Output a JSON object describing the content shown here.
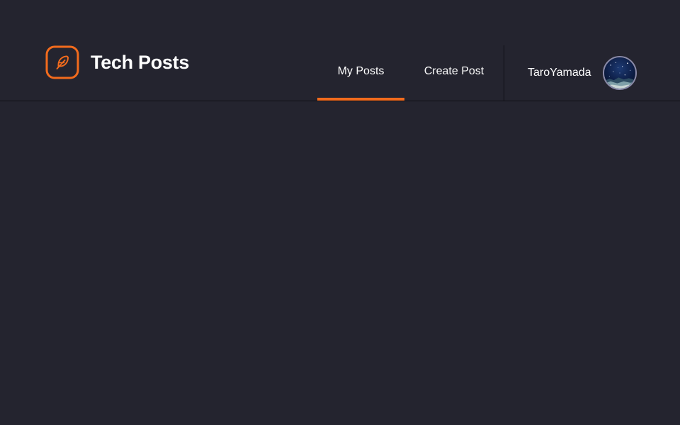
{
  "brand": {
    "name": "Tech Posts",
    "logo_icon": "feather-icon",
    "accent_color": "#f26b1d"
  },
  "nav": {
    "tabs": [
      {
        "label": "My Posts",
        "active": true
      },
      {
        "label": "Create Post",
        "active": false
      }
    ]
  },
  "user": {
    "name": "TaroYamada",
    "avatar_icon": "avatar-starry-sky"
  },
  "theme": {
    "background": "#24242f",
    "header_border": "#0f0f15",
    "text": "#ffffff"
  }
}
